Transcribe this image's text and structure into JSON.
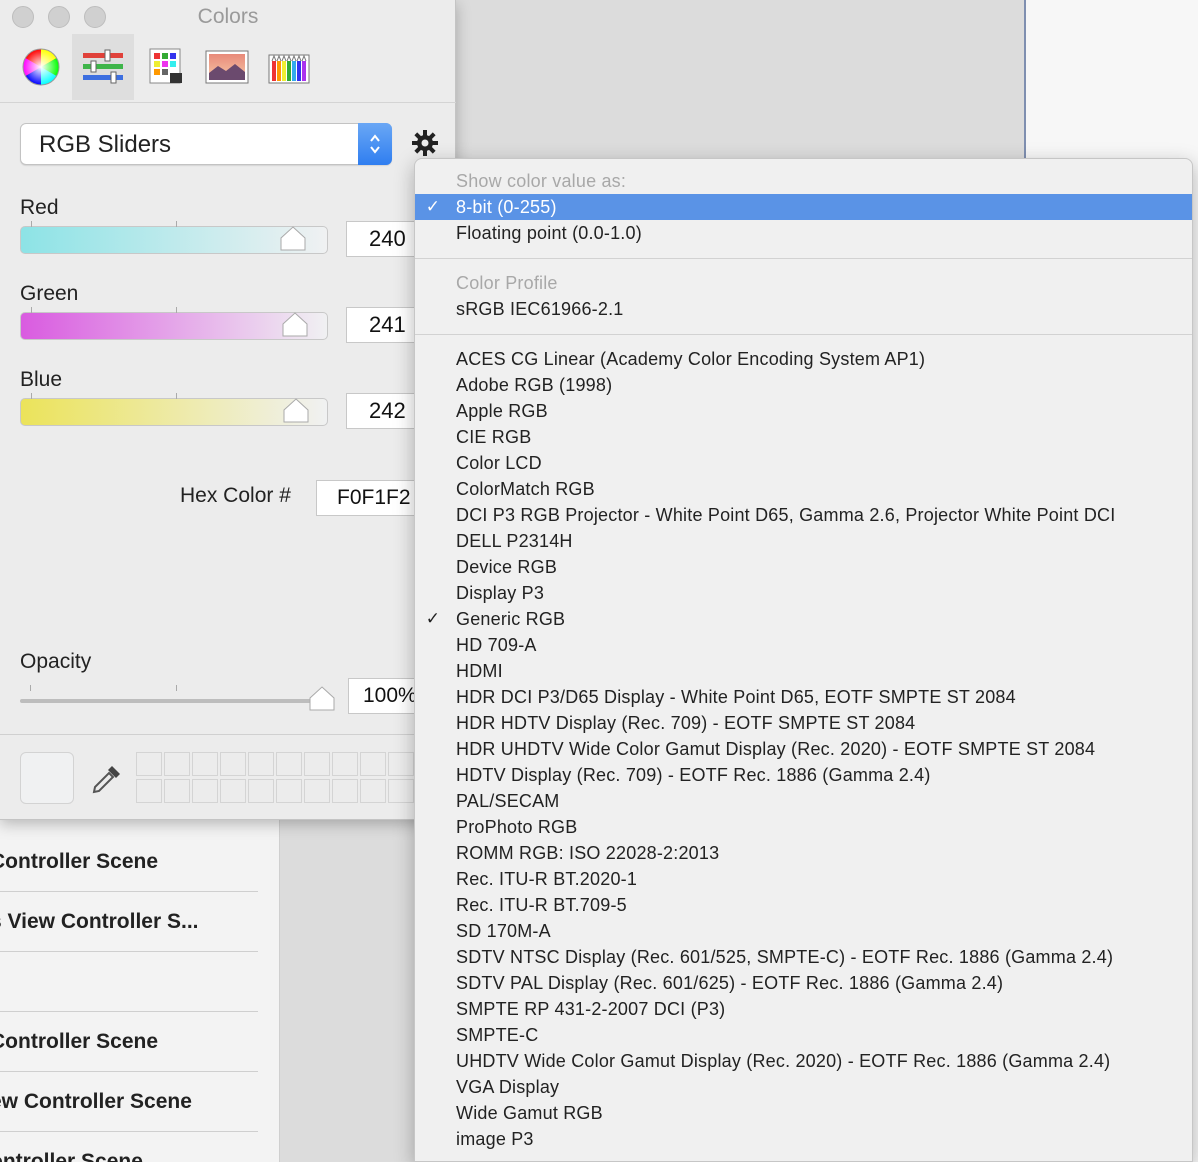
{
  "window": {
    "title": "Colors"
  },
  "toolbar": {
    "tools": [
      {
        "icon": "color-wheel-icon"
      },
      {
        "icon": "color-sliders-icon",
        "selected": true
      },
      {
        "icon": "color-palettes-icon"
      },
      {
        "icon": "image-palettes-icon"
      },
      {
        "icon": "pencils-icon"
      }
    ]
  },
  "mode": {
    "label": "RGB Sliders"
  },
  "sliders": [
    {
      "label": "Red",
      "value": "240",
      "level": 240
    },
    {
      "label": "Green",
      "value": "241",
      "level": 241
    },
    {
      "label": "Blue",
      "value": "242",
      "level": 242
    }
  ],
  "hex": {
    "label": "Hex Color #",
    "value": "F0F1F2"
  },
  "opacity": {
    "label": "Opacity",
    "value": "100%"
  },
  "colors": {
    "current": "#F0F1F2",
    "accent": "#5A93E6",
    "red_track_start": "#8de3e6",
    "green_track_start": "#d95be0",
    "blue_track_start": "#ebe35a"
  },
  "background_list": {
    "items": [
      "Controller Scene",
      "s View Controller S...",
      "",
      "Controller Scene",
      "ew Controller Scene",
      "ontroller Scene"
    ]
  },
  "menu": {
    "value_header": "Show color value as:",
    "value_options": [
      {
        "label": "8-bit (0-255)",
        "checked": true,
        "highlighted": true
      },
      {
        "label": "Floating point (0.0-1.0)",
        "checked": false
      }
    ],
    "profile_header": "Color Profile",
    "current_profile": "sRGB IEC61966-2.1",
    "profiles": [
      {
        "label": "ACES CG Linear (Academy Color Encoding System AP1)"
      },
      {
        "label": "Adobe RGB (1998)"
      },
      {
        "label": "Apple RGB"
      },
      {
        "label": "CIE RGB"
      },
      {
        "label": "Color LCD"
      },
      {
        "label": "ColorMatch RGB"
      },
      {
        "label": "DCI P3 RGB Projector - White Point D65, Gamma 2.6, Projector White Point DCI"
      },
      {
        "label": "DELL P2314H"
      },
      {
        "label": "Device RGB"
      },
      {
        "label": "Display P3"
      },
      {
        "label": "Generic RGB",
        "checked": true
      },
      {
        "label": "HD 709-A"
      },
      {
        "label": "HDMI"
      },
      {
        "label": "HDR DCI P3/D65 Display - White Point D65, EOTF SMPTE ST 2084"
      },
      {
        "label": "HDR HDTV Display (Rec. 709) - EOTF SMPTE ST 2084"
      },
      {
        "label": "HDR UHDTV Wide Color Gamut Display (Rec. 2020) - EOTF SMPTE ST 2084"
      },
      {
        "label": "HDTV Display (Rec. 709) - EOTF Rec. 1886 (Gamma 2.4)"
      },
      {
        "label": "PAL/SECAM"
      },
      {
        "label": "ProPhoto RGB"
      },
      {
        "label": "ROMM RGB: ISO 22028-2:2013"
      },
      {
        "label": "Rec. ITU-R BT.2020-1"
      },
      {
        "label": "Rec. ITU-R BT.709-5"
      },
      {
        "label": "SD 170M-A"
      },
      {
        "label": "SDTV NTSC Display (Rec. 601/525, SMPTE-C) - EOTF Rec. 1886 (Gamma 2.4)"
      },
      {
        "label": "SDTV PAL Display (Rec. 601/625) - EOTF Rec. 1886 (Gamma 2.4)"
      },
      {
        "label": "SMPTE RP 431-2-2007 DCI (P3)"
      },
      {
        "label": "SMPTE-C"
      },
      {
        "label": "UHDTV Wide Color Gamut Display (Rec. 2020) - EOTF Rec. 1886 (Gamma 2.4)"
      },
      {
        "label": "VGA Display"
      },
      {
        "label": "Wide Gamut RGB"
      },
      {
        "label": "image P3"
      }
    ]
  }
}
